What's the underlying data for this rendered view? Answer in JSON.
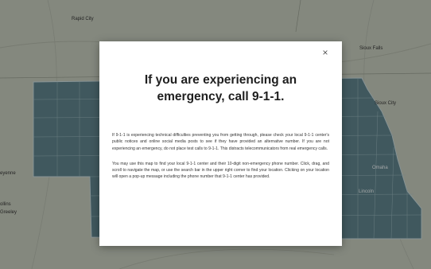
{
  "map": {
    "labels": {
      "rapid_city": "Rapid City",
      "sioux_falls": "Sioux Falls",
      "sioux_city": "Sioux City",
      "omaha": "Omaha",
      "lincoln": "Lincoln",
      "cheyenne": "eyenne",
      "collins": "ollins",
      "greeley": "Greeley"
    },
    "colors": {
      "land": "#bdc3b3",
      "region": "#4f7780",
      "region_border": "#c2d7db"
    }
  },
  "modal": {
    "close_symbol": "×",
    "title": "If you are experiencing an emergency, call 9-1-1.",
    "paragraph_1": "If 9-1-1 is experiencing technical difficulties preventing you from getting through, please check your local 9-1-1 center's public notices and online social media posts to see if they have provided an alternative number. If you are not experiencing an emergency, do not place test calls to 9-1-1. This distracts telecommunicators from real emergency calls.",
    "paragraph_2": "You may use this map to find your local 9-1-1 center and their 10-digit non-emergency phone number. Click, drag, and scroll to navigate the map, or use the search bar in the upper right corner to find your location. Clicking on your location will open a pop-up message including the phone number that 9-1-1 center has provided."
  }
}
